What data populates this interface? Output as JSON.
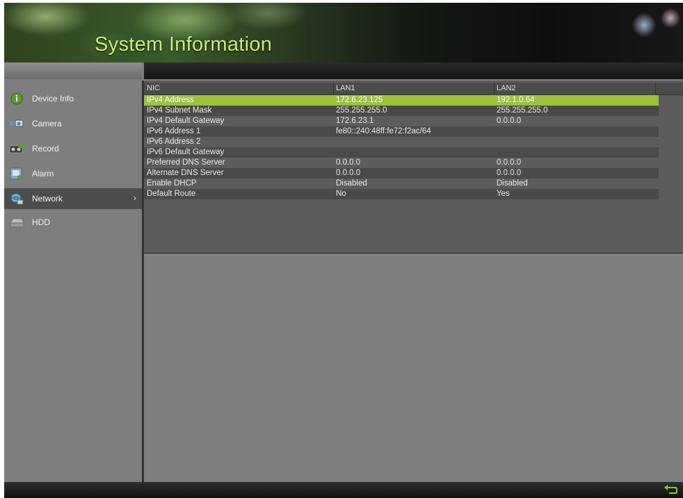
{
  "header": {
    "title": "System Information"
  },
  "sidebar": {
    "items": [
      {
        "label": "Device Info",
        "icon": "info-icon"
      },
      {
        "label": "Camera",
        "icon": "camera-icon"
      },
      {
        "label": "Record",
        "icon": "record-icon"
      },
      {
        "label": "Alarm",
        "icon": "alarm-icon"
      },
      {
        "label": "Network",
        "icon": "network-icon",
        "active": true,
        "chevron": "›"
      },
      {
        "label": "HDD",
        "icon": "hdd-icon"
      }
    ]
  },
  "table": {
    "columns": [
      "NIC",
      "LAN1",
      "LAN2"
    ],
    "rows": [
      [
        "IPv4 Address",
        "172.6.23.125",
        "192.1.0.64"
      ],
      [
        "IPv4 Subnet Mask",
        "255.255.255.0",
        "255.255.255.0"
      ],
      [
        "IPv4 Default Gateway",
        "172.6.23.1",
        "0.0.0.0"
      ],
      [
        "IPv6 Address 1",
        "fe80::240:48ff:fe72:f2ac/64",
        ""
      ],
      [
        "IPv6 Address 2",
        "",
        ""
      ],
      [
        "IPv6 Default Gateway",
        "",
        ""
      ],
      [
        "Preferred DNS Server",
        "0.0.0.0",
        "0.0.0.0"
      ],
      [
        "Alternate DNS Server",
        "0.0.0.0",
        "0.0.0.0"
      ],
      [
        "Enable DHCP",
        "Disabled",
        "Disabled"
      ],
      [
        "Default Route",
        "No",
        "Yes"
      ]
    ]
  },
  "colors": {
    "accent": "#9bc23a",
    "title": "#c7f07a"
  }
}
